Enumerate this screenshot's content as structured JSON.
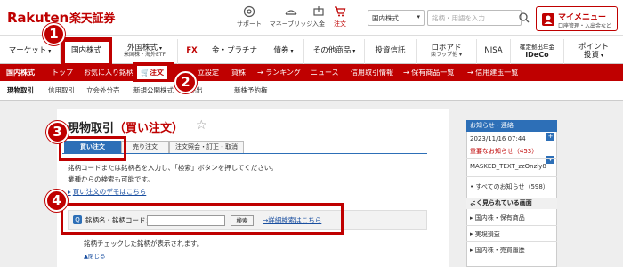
{
  "brand": {
    "logo_latin": "Rakuten",
    "logo_jp": "楽天証券"
  },
  "header": {
    "icons": [
      {
        "label": "サポート",
        "icon": "support-icon"
      },
      {
        "label": "マネーブリッジ",
        "icon": "money-bridge-icon"
      },
      {
        "label": "入金",
        "icon": "deposit-icon"
      },
      {
        "label": "注文",
        "icon": "cart-icon"
      }
    ],
    "search_scope": "国内株式",
    "search_placeholder": "銘柄・用語を入力",
    "mymenu_title": "マイメニュー",
    "mymenu_sub": "口座管理・入出金など"
  },
  "global_nav": [
    {
      "label": "マーケット",
      "sub": "",
      "caret": true
    },
    {
      "label": "国内株式",
      "sub": "",
      "caret": false,
      "active": true
    },
    {
      "label": "外国株式",
      "sub": "米国株・海外ETF",
      "caret": true
    },
    {
      "label": "FX",
      "sub": "",
      "caret": false
    },
    {
      "label": "金・プラチナ",
      "sub": "",
      "caret": false
    },
    {
      "label": "債券",
      "sub": "",
      "caret": true
    },
    {
      "label": "その他商品",
      "sub": "",
      "caret": true
    },
    {
      "label": "投資信託",
      "sub": "",
      "caret": false
    },
    {
      "label": "ロボアド",
      "sub": "楽ラップ他",
      "caret": true
    },
    {
      "label": "NISA",
      "sub": "",
      "caret": false
    },
    {
      "label": "確定拠出年金",
      "sub": "iDeCo",
      "caret": false
    },
    {
      "label": "ポイント",
      "sub": "投資",
      "caret": true
    }
  ],
  "red_nav": {
    "current": "国内株式",
    "items": [
      "トップ",
      "お気に入り銘柄",
      "注文",
      "立設定",
      "貸株",
      "→ ランキング",
      "ニュース",
      "信用取引情報",
      "→ 保有商品一覧",
      "→ 信用建玉一覧"
    ]
  },
  "sub_nav": [
    "現物取引",
    "信用取引",
    "立会外分売",
    "新規公開株式",
    "・売出",
    "新株予約権"
  ],
  "page": {
    "title_prefix": "現物取引",
    "title_suffix": "（買い注文）",
    "tabs": [
      "買い注文",
      "売り注文",
      "注文照会・訂正・取消"
    ],
    "desc_line1": "銘柄コードまたは銘柄名を入力し、「検索」ボタンを押してください。",
    "desc_line2": "業種からの検索も可能です。",
    "link1": "買い注文のデモはこちら",
    "search_label": "銘柄名・銘柄コード：",
    "search_button": "検索",
    "detail_link": "→詳細検索はこちら",
    "lower_text": "銘柄チェックした銘柄が表示されます。",
    "lower_close": "▲閉じる"
  },
  "right_panel": {
    "header": "お知らせ・連絡",
    "date": "2023/11/16 07:44",
    "alert": "重要なお知らせ（453）",
    "masked": "MASKED_TEXT_zzOnzly8",
    "all_notices": "• すべてのお知らせ（598）",
    "recent_header": "よく見られている画面",
    "recent": [
      "国内株・保有商品",
      "実現損益",
      "国内株・売買履歴"
    ]
  },
  "callouts": [
    "1",
    "2",
    "3",
    "4"
  ],
  "colors": {
    "brand_red": "#bf0000",
    "tab_blue": "#2d6fb7",
    "link_blue": "#1a4fa0"
  }
}
